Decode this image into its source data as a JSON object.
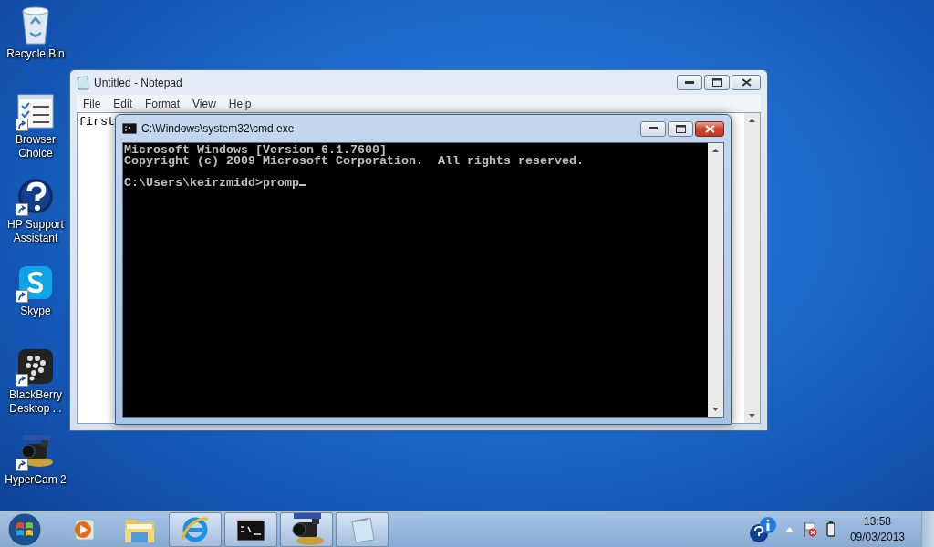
{
  "desktop_icons": [
    {
      "label": "Recycle Bin",
      "kind": "recycle",
      "shortcut": false
    },
    {
      "label": "Browser Choice",
      "kind": "checklist",
      "shortcut": true
    },
    {
      "label": "HP Support Assistant",
      "kind": "help",
      "shortcut": true
    },
    {
      "label": "Skype",
      "kind": "chat",
      "shortcut": true
    },
    {
      "label": "BlackBerry Desktop ...",
      "kind": "phone",
      "shortcut": true
    },
    {
      "label": "HyperCam 2",
      "kind": "camera",
      "shortcut": true
    }
  ],
  "notepad": {
    "title": "Untitled - Notepad",
    "active": false,
    "menu": [
      "File",
      "Edit",
      "Format",
      "View",
      "Help"
    ],
    "text": "first"
  },
  "cmd": {
    "title": "C:\\Windows\\system32\\cmd.exe",
    "active": true,
    "output_lines": [
      "Microsoft Windows [Version 6.1.7600]",
      "Copyright (c) 2009 Microsoft Corporation.  All rights reserved."
    ],
    "prompt_line": "C:\\Users\\keirzmidd>promp"
  },
  "taskbar": {
    "items": [
      {
        "kind": "media",
        "running": false
      },
      {
        "kind": "folder",
        "running": false
      },
      {
        "kind": "browser",
        "running": true
      },
      {
        "kind": "console",
        "running": true
      },
      {
        "kind": "camera",
        "running": true
      },
      {
        "kind": "notepad",
        "running": true
      }
    ],
    "clock": {
      "time": "13:58",
      "date": "09/03/2013"
    }
  }
}
